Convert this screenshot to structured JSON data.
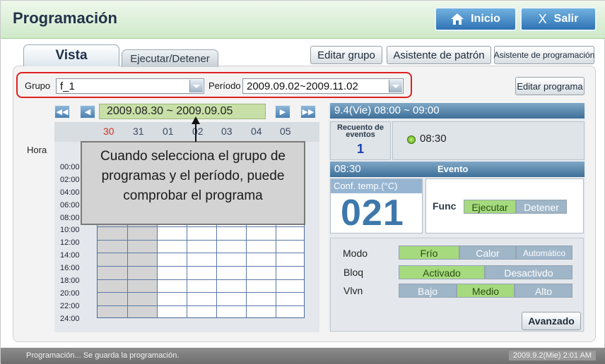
{
  "window": {
    "title": "Programación"
  },
  "top_buttons": {
    "home_label": "Inicio",
    "exit_label": "Salir",
    "exit_glyph": "X"
  },
  "tabs": [
    {
      "label": "Vista"
    },
    {
      "label": "Ejecutar/Detener"
    }
  ],
  "toolbar": {
    "edit_group": "Editar grupo",
    "pattern_wizard": "Asistente de patrón",
    "schedule_wizard": "Asistente de programación",
    "edit_program": "Editar programa"
  },
  "filters": {
    "group_label": "Grupo",
    "group_value": "f_1",
    "period_label": "Período",
    "period_value": "2009.09.02~2009.11.02"
  },
  "calendar": {
    "range": "2009.08.30 ~ 2009.09.05",
    "days": [
      "30",
      "31",
      "01",
      "02",
      "03",
      "04",
      "05"
    ],
    "highlight_color": "#d03020",
    "hour_label": "Hora",
    "times": [
      "00:00",
      "02:00",
      "04:00",
      "06:00",
      "08:00",
      "10:00",
      "12:00",
      "14:00",
      "16:00",
      "18:00",
      "20:00",
      "22:00",
      "24:00"
    ]
  },
  "callout": {
    "text": "Cuando selecciona el grupo de programas y el período, puede comprobar el programa"
  },
  "event_panel": {
    "header": "9.4(Vie) 08:00 ~ 09:00",
    "count_label": "Recuento de eventos",
    "count": "1",
    "event_time": "08:30",
    "detail_time": "08:30",
    "detail_title": "Evento"
  },
  "temperature": {
    "label": "Conf. temp.(°C)",
    "value": "021"
  },
  "func": {
    "label": "Func",
    "options": [
      "Ejecutar",
      "Detener"
    ],
    "selected": "Ejecutar"
  },
  "options": {
    "mode": {
      "label": "Modo",
      "values": [
        "Frío",
        "Calor",
        "Automático"
      ],
      "selected": "Frío"
    },
    "lock": {
      "label": "Bloq",
      "values": [
        "Activado",
        "Desactivdo"
      ],
      "selected": "Activado"
    },
    "fan": {
      "label": "Vlvn",
      "values": [
        "Bajo",
        "Medio",
        "Alto"
      ],
      "selected": "Medio"
    }
  },
  "advanced_label": "Avanzado",
  "status": {
    "message": "Programación... Se guarda la programación.",
    "datetime": "2009.9.2(Mie)  2:01 AM"
  },
  "icons": [
    "home-icon",
    "close-icon",
    "first-page-icon",
    "prev-page-icon",
    "next-page-icon",
    "last-page-icon",
    "dropdown-arrow-icon",
    "status-led-icon"
  ]
}
